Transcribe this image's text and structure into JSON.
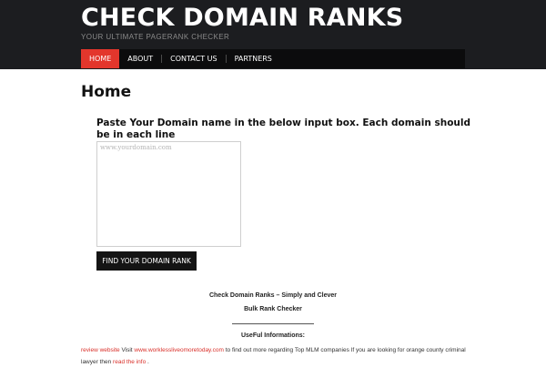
{
  "header": {
    "site_title": "CHECK DOMAIN RANKS",
    "tagline": "YOUR ULTIMATE PAGERANK CHECKER",
    "background_color": "#1c1d20"
  },
  "nav": {
    "items": [
      {
        "label": "HOME",
        "active": true
      },
      {
        "label": "ABOUT",
        "active": false
      },
      {
        "label": "CONTACT US",
        "active": false
      },
      {
        "label": "PARTNERS",
        "active": false
      }
    ],
    "active_color": "#e3362c",
    "bar_color": "#0c0c0d"
  },
  "main": {
    "page_title": "Home",
    "instructions": "Paste Your Domain name in the below input box. Each domain should be in each line",
    "domain_input": {
      "value": "",
      "placeholder": "www.yourdomain.com"
    },
    "submit_label": "FIND YOUR DOMAIN RANK",
    "tagline_line1": "Check Domain Ranks – Simply and Clever",
    "tagline_line2": "Bulk Rank Checker",
    "useful_heading": "UseFul Informations:"
  },
  "footer": {
    "link_review": "review website",
    "text_visit": " Visit ",
    "link_worklessliveomore": "www.worklessliveomoretoday.com",
    "text_mid": " to find out more regarding Top MLM companies If you are looking for orange county criminal lawyer then ",
    "link_read": "read the info",
    "text_end": " .",
    "link_color": "#d9302a"
  }
}
